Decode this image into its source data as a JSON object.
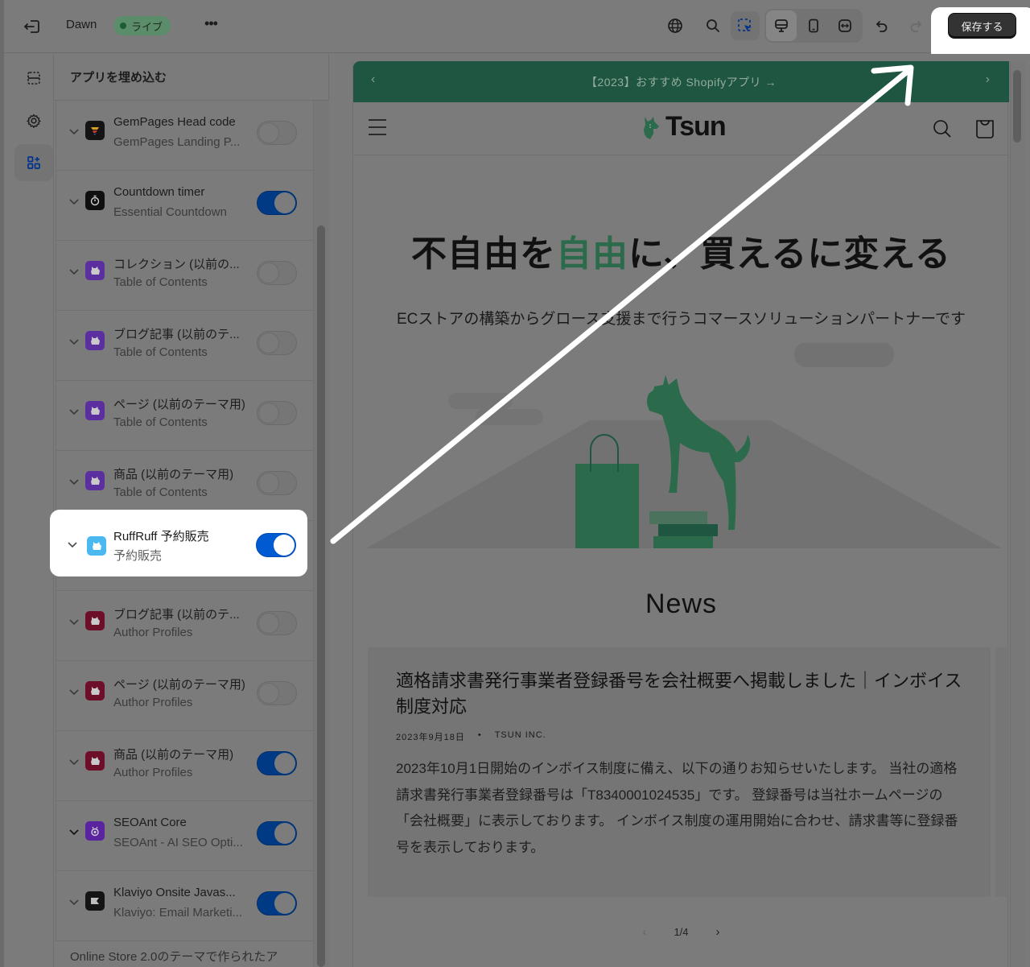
{
  "topbar": {
    "theme_name": "Dawn",
    "status_badge": "ライブ",
    "more_label": "•••",
    "icons": [
      "exit-icon",
      "globe-icon",
      "search-icon",
      "inspector-select-icon",
      "desktop-view-icon",
      "mobile-view-icon",
      "fullwidth-view-icon",
      "undo-icon",
      "redo-icon"
    ],
    "save_label": "保存する"
  },
  "rail": {
    "items": [
      {
        "name": "sections-icon",
        "active": false
      },
      {
        "name": "theme-settings-icon",
        "active": false
      },
      {
        "name": "app-embeds-icon",
        "active": true
      }
    ]
  },
  "panel": {
    "title": "アプリを埋め込む",
    "apps": [
      {
        "name": "GemPages Head code",
        "source": "GemPages Landing P...",
        "enabled": false,
        "icon": "gempages-icon"
      },
      {
        "name": "Countdown timer",
        "source": "Essential Countdown",
        "enabled": true,
        "icon": "stopwatch-icon"
      },
      {
        "name": "コレクション (以前の...",
        "source": "Table of Contents",
        "enabled": false,
        "icon": "dog-purple-icon"
      },
      {
        "name": "ブログ記事 (以前のテ...",
        "source": "Table of Contents",
        "enabled": false,
        "icon": "dog-purple-icon"
      },
      {
        "name": "ページ (以前のテーマ用)",
        "source": "Table of Contents",
        "enabled": false,
        "icon": "dog-purple-icon"
      },
      {
        "name": "商品 (以前のテーマ用)",
        "source": "Table of Contents",
        "enabled": false,
        "icon": "dog-purple-icon"
      },
      {
        "name": "RuffRuff 予約販売",
        "source": "予約販売",
        "enabled": true,
        "icon": "dog-blue-icon",
        "highlighted": true
      },
      {
        "name": "ブログ記事 (以前のテ...",
        "source": "Author Profiles",
        "enabled": false,
        "icon": "dog-maroon-icon"
      },
      {
        "name": "ページ (以前のテーマ用)",
        "source": "Author Profiles",
        "enabled": false,
        "icon": "dog-maroon-icon"
      },
      {
        "name": "商品 (以前のテーマ用)",
        "source": "Author Profiles",
        "enabled": true,
        "icon": "dog-maroon-icon"
      },
      {
        "name": "SEOAnt Core",
        "source": "SEOAnt - AI SEO Opti...",
        "enabled": true,
        "icon": "seoant-icon"
      },
      {
        "name": "Klaviyo Onsite Javas...",
        "source": "Klaviyo: Email Marketi...",
        "enabled": true,
        "icon": "klaviyo-icon"
      }
    ],
    "footer_text": "Online Store 2.0のテーマで作られたア"
  },
  "preview": {
    "announcement": "【2023】おすすめ Shopifyアプリ →",
    "logo_text": "Tsun",
    "hero_title_pre": "不自由を",
    "hero_title_accent": "自由",
    "hero_title_post": "に、買えるに変える",
    "hero_subtitle": "ECストアの構築からグロース支援まで行うコマースソリューションパートナーです",
    "news_heading": "News",
    "article": {
      "title": "適格請求書発行事業者登録番号を会社概要へ掲載しました｜インボイス制度対応",
      "date": "2023年9月18日",
      "separator": "•",
      "author": "TSUN INC.",
      "body": "2023年10月1日開始のインボイス制度に備え、以下の通りお知らせいたします。 当社の適格請求書発行事業者登録番号は「T8340001024535」です。 登録番号は当社ホームページの「会社概要」に表示しております。 インボイス制度の運用開始に合わせ、請求書等に登録番号を表示しております。"
    },
    "pagination": {
      "prev": "‹",
      "current": "1/4",
      "next": "›"
    }
  },
  "colors": {
    "brand_green": "#2b6a4a",
    "announcement_bg": "#1f5642",
    "toggle_on": "#005bd3",
    "save_button": "#333333"
  }
}
